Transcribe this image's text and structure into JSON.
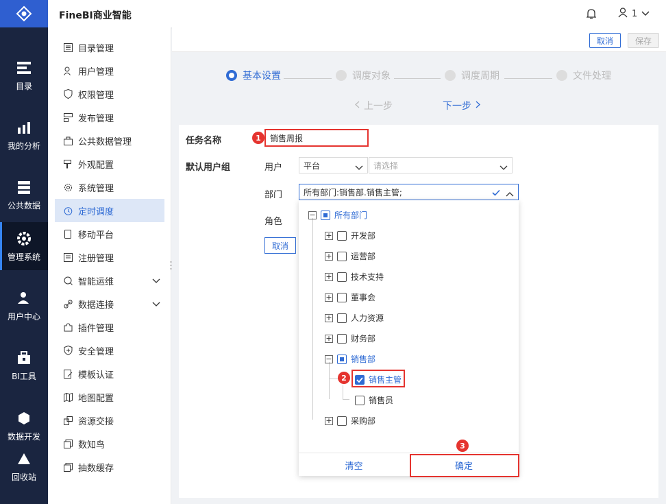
{
  "app": {
    "title": "FineBI商业智能",
    "user": "1"
  },
  "rail": [
    {
      "label": "目录",
      "icon": "catalog-icon"
    },
    {
      "label": "我的分析",
      "icon": "analysis-icon"
    },
    {
      "label": "公共数据",
      "icon": "database-icon"
    },
    {
      "label": "管理系统",
      "icon": "gear-icon"
    },
    {
      "label": "用户中心",
      "icon": "user-center-icon"
    },
    {
      "label": "BI工具",
      "icon": "toolbox-icon"
    },
    {
      "label": "数据开发",
      "icon": "hexagon-icon"
    },
    {
      "label": "回收站",
      "icon": "recycle-icon"
    }
  ],
  "menu": [
    {
      "label": "目录管理"
    },
    {
      "label": "用户管理"
    },
    {
      "label": "权限管理"
    },
    {
      "label": "发布管理"
    },
    {
      "label": "公共数据管理"
    },
    {
      "label": "外观配置"
    },
    {
      "label": "系统管理"
    },
    {
      "label": "定时调度"
    },
    {
      "label": "移动平台"
    },
    {
      "label": "注册管理"
    },
    {
      "label": "智能运维"
    },
    {
      "label": "数据连接"
    },
    {
      "label": "插件管理"
    },
    {
      "label": "安全管理"
    },
    {
      "label": "模板认证"
    },
    {
      "label": "地图配置"
    },
    {
      "label": "资源交接"
    },
    {
      "label": "数知鸟"
    },
    {
      "label": "抽数缓存"
    }
  ],
  "toolbar": {
    "cancel": "取消",
    "save": "保存"
  },
  "steps": [
    {
      "label": "基本设置"
    },
    {
      "label": "调度对象"
    },
    {
      "label": "调度周期"
    },
    {
      "label": "文件处理"
    }
  ],
  "nav": {
    "prev": "上一步",
    "next": "下一步"
  },
  "form": {
    "task_name_label": "任务名称",
    "task_name_value": "销售周报",
    "default_group_label": "默认用户组",
    "user_label": "用户",
    "user_type": "平台",
    "user_placeholder": "请选择",
    "dept_label": "部门",
    "dept_value": "所有部门:销售部.销售主管;",
    "role_label": "角色",
    "cancel": "取消"
  },
  "tree": {
    "root": "所有部门",
    "nodes": [
      "开发部",
      "运营部",
      "技术支持",
      "董事会",
      "人力资源",
      "财务部",
      "销售部",
      "销售主管",
      "销售员",
      "采购部"
    ]
  },
  "dropdown": {
    "clear": "清空",
    "confirm": "确定"
  },
  "badges": [
    "1",
    "2",
    "3"
  ],
  "colors": {
    "accent": "#2f6bd4",
    "highlight": "#e5342f",
    "rail": "#1a2540"
  }
}
